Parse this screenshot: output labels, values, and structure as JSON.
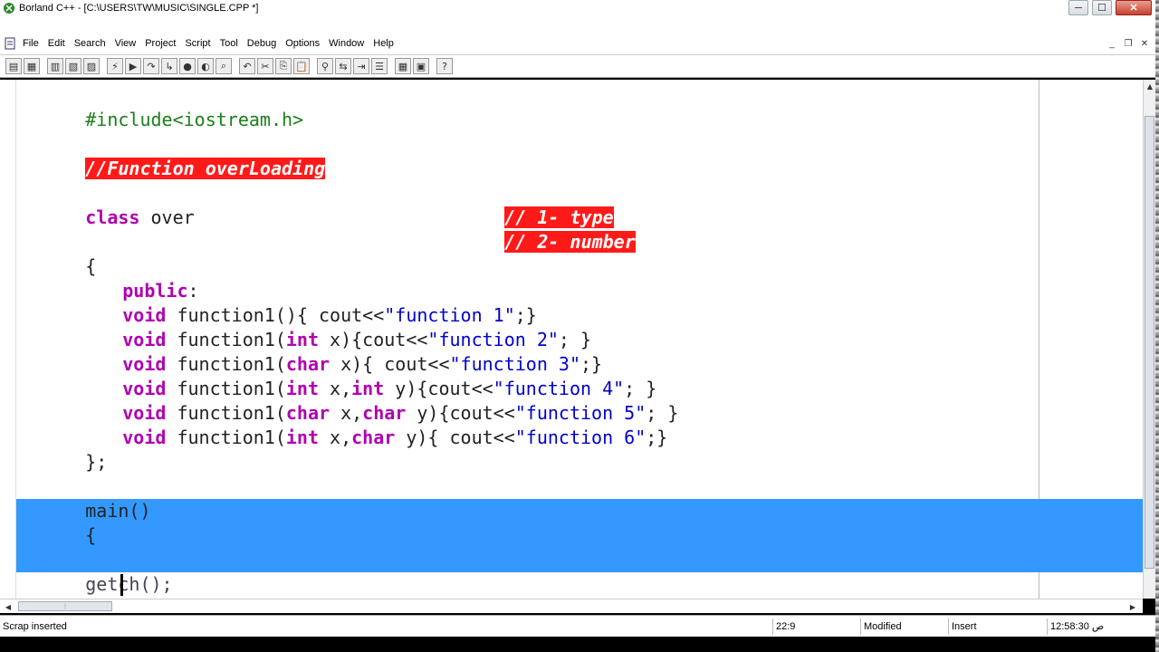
{
  "window": {
    "title": "Borland C++ - [C:\\USERS\\TW\\MUSIC\\SINGLE.CPP *]",
    "controls": {
      "minimize": "─",
      "maximize": "☐",
      "close": "✕"
    }
  },
  "menu": {
    "items": [
      "File",
      "Edit",
      "Search",
      "View",
      "Project",
      "Script",
      "Tool",
      "Debug",
      "Options",
      "Window",
      "Help"
    ],
    "mdi": {
      "minimize": "_",
      "restore": "❐",
      "close": "✕"
    }
  },
  "toolbar": {
    "buttons": [
      "open-icon",
      "save-icon",
      "print-icon",
      "compile-icon",
      "make-icon",
      "build-icon",
      "run-icon",
      "step-icon",
      "trace-icon",
      "breakpoint-icon",
      "watch-icon",
      "inspect-icon",
      "stop-icon",
      "undo-icon",
      "cut-icon",
      "copy-icon",
      "paste-icon",
      "search-icon",
      "replace-icon",
      "find-next-icon",
      "browse-icon",
      "help-icon"
    ]
  },
  "editor": {
    "lines": {
      "l1": "#include<iostream.h>",
      "l2": "//Function overLoading",
      "l3_kw": "class",
      "l3_rest": " over",
      "l3_comment": "// 1- type",
      "l4_comment": "// 2- number",
      "l5": "{",
      "l6_kw": "public",
      "l6_rest": ":",
      "f1_kw": "void",
      "f1_a": " function1(){ cout<<",
      "f1_s": "\"function 1\"",
      "f1_b": ";}",
      "f2_kw": "void",
      "f2_a": " function1(",
      "f2_kw2": "int",
      "f2_b": " x){cout<<",
      "f2_s": "\"function 2\"",
      "f2_c": "; }",
      "f3_kw": "void",
      "f3_a": " function1(",
      "f3_kw2": "char",
      "f3_b": " x){ cout<<",
      "f3_s": "\"function 3\"",
      "f3_c": ";}",
      "f4_kw": "void",
      "f4_a": " function1(",
      "f4_kw2": "int",
      "f4_b": " x,",
      "f4_kw3": "int",
      "f4_c": " y){cout<<",
      "f4_s": "\"function 4\"",
      "f4_d": "; }",
      "f5_kw": "void",
      "f5_a": " function1(",
      "f5_kw2": "char",
      "f5_b": " x,",
      "f5_kw3": "char",
      "f5_c": " y){cout<<",
      "f5_s": "\"function 5\"",
      "f5_d": "; }",
      "f6_kw": "void",
      "f6_a": " function1(",
      "f6_kw2": "int",
      "f6_b": " x,",
      "f6_kw3": "char",
      "f6_c": " y){ cout<<",
      "f6_s": "\"function 6\"",
      "f6_d": ";}",
      "l13": "};",
      "l15": "main()",
      "l16": "{",
      "l18": "getch();",
      "l19": "}"
    }
  },
  "statusbar": {
    "message": "Scrap inserted",
    "position": "22:9",
    "modified": "Modified",
    "mode": "Insert",
    "clock": "12:58:30 ص"
  },
  "colors": {
    "selection": "#3399ff",
    "highlight_red": "#ff1a1a",
    "keyword": "#b000b0",
    "string": "#0000cc",
    "preprocessor": "#1a7f1a"
  }
}
